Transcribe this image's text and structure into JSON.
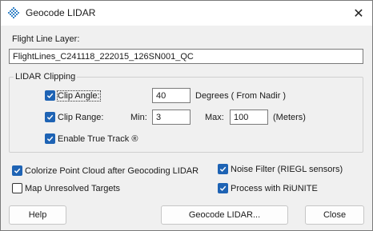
{
  "window": {
    "title": "Geocode LIDAR",
    "app_icon": "diamond-grid-icon",
    "close_icon": "close-icon",
    "close_glyph": "✕"
  },
  "flight_line": {
    "label": "Flight Line Layer:",
    "value": "FlightLines_C241118_222015_126SN001_QC"
  },
  "lidar_clipping": {
    "group_title": "LIDAR Clipping",
    "clip_angle": {
      "label": "Clip Angle:",
      "checked": true,
      "value": "40",
      "unit": "Degrees ( From Nadir )"
    },
    "clip_range": {
      "label": "Clip Range:",
      "checked": true,
      "min_label": "Min:",
      "min_value": "3",
      "max_label": "Max:",
      "max_value": "100",
      "unit": "(Meters)"
    },
    "true_track": {
      "label": "Enable True Track ®",
      "checked": true
    }
  },
  "options": {
    "colorize": {
      "label": "Colorize Point Cloud after Geocoding LIDAR",
      "checked": true
    },
    "map_unresolved": {
      "label": "Map Unresolved Targets",
      "checked": false
    },
    "noise_filter": {
      "label": "Noise Filter (RIEGL sensors)",
      "checked": true
    },
    "riunite": {
      "label": "Process with RiUNITE",
      "checked": true
    }
  },
  "buttons": {
    "help": "Help",
    "geocode": "Geocode LIDAR...",
    "close": "Close"
  },
  "colors": {
    "accent": "#1e63b4",
    "dialog_bg": "#f0f0f0"
  }
}
